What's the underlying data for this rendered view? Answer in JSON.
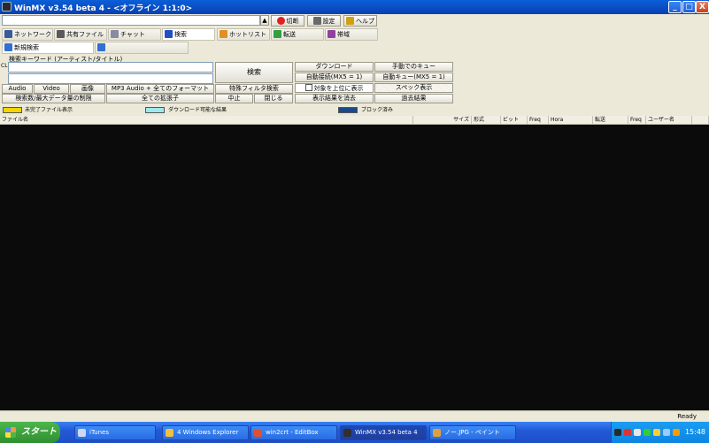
{
  "window": {
    "title": "WinMX v3.54 beta 4 - <オフライン 1:1:0>",
    "controls": [
      "_",
      "□",
      "X"
    ]
  },
  "toolbar": {
    "search_field_value": "",
    "buttons": [
      {
        "label": "切断",
        "icon": "no-entry-icon"
      },
      {
        "label": "設定",
        "icon": "settings-icon"
      },
      {
        "label": "ヘルプ",
        "icon": "help-icon"
      }
    ]
  },
  "tabs": [
    {
      "label": "ネットワーク",
      "icon": "network-icon"
    },
    {
      "label": "共有ファイル",
      "icon": "shared-files-icon"
    },
    {
      "label": "チャット",
      "icon": "chat-icon"
    },
    {
      "label": "検索",
      "icon": "search-icon",
      "selected": true
    },
    {
      "label": "ホットリスト",
      "icon": "hotlist-icon"
    },
    {
      "label": "転送",
      "icon": "transfer-icon"
    },
    {
      "label": "帯域",
      "icon": "bandwidth-icon"
    }
  ],
  "subtabs": [
    {
      "label": "新規検索",
      "icon": "new-search-icon"
    },
    {
      "label": "",
      "icon": "search-result-icon"
    }
  ],
  "search": {
    "keyword_label": "検索キーワード (アーティスト/タイトル)",
    "side_label": "CLEAR",
    "search_button": "検索",
    "type_buttons": [
      "Audio",
      "Video",
      "画像",
      "MP3 Audio + 全てのフォーマット"
    ],
    "filter_button": "特殊フィルタ検索",
    "bottom_buttons": [
      "検索数/最大データ量の制限",
      "全ての拡張子"
    ],
    "stop_button": "中止",
    "close_button": "閉じる"
  },
  "right_panel": {
    "rows": [
      [
        "ダウンロード",
        "手動でのキュー"
      ],
      [
        "自動接続(MX5 = 1)",
        "自動キュー(MX5 = 1)"
      ],
      [
        "対象を上位に表示",
        "スペック表示"
      ],
      [
        "表示結果を消去",
        "過去結果"
      ]
    ]
  },
  "legend": [
    {
      "label": "未完了ファイル表示",
      "color": "#f6d400"
    },
    {
      "label": "ダウンロード可能な結果",
      "color": "#9ee8f0"
    },
    {
      "label": "ブロック済み",
      "color": "#1a4a8a"
    }
  ],
  "columns": [
    "ファイル名",
    "サイズ",
    "形式",
    "ビット",
    "Freq",
    "Hora",
    "転送",
    "Freq",
    "ユーザー名"
  ],
  "status_text": "Ready",
  "taskbar": {
    "start_label": "スタート",
    "tasks": [
      {
        "label": "iTunes",
        "icon": "itunes-icon",
        "color": "#d0d8f0"
      },
      {
        "label": "4 Windows Explorer",
        "icon": "folder-icon",
        "color": "#f0c040"
      },
      {
        "label": "win2crt - EditBox",
        "icon": "editor-icon",
        "color": "#e05030"
      },
      {
        "label": "WinMX v3.54 beta 4",
        "icon": "winmx-icon",
        "color": "#303030",
        "active": true
      },
      {
        "label": "ノー.JPG - ペイント",
        "icon": "paint-icon",
        "color": "#e0a040"
      }
    ],
    "clock": "15:48"
  }
}
